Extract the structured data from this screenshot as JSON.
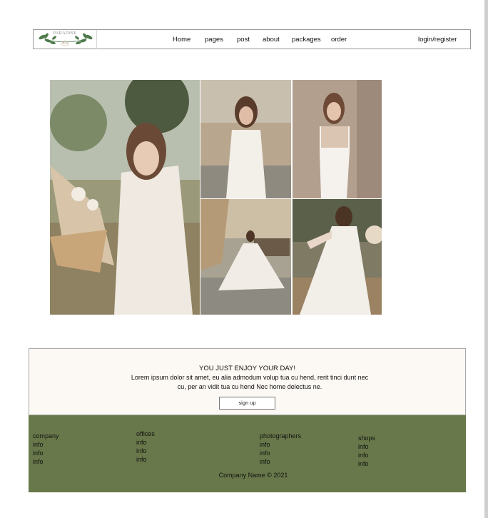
{
  "nav": {
    "logo_text": "PARADISE",
    "links": [
      "Home",
      "pages",
      "post",
      "about",
      "packages",
      "order"
    ],
    "login": "login/register"
  },
  "gallery": {
    "photos": [
      "bride-with-bouquet",
      "bride-in-garden",
      "bride-by-stone-wall",
      "bride-twirling-at-table",
      "bride-in-meadow"
    ]
  },
  "cta": {
    "heading": "YOU JUST ENJOY YOUR DAY!",
    "body": "Lorem ipsum dolor sit amet, eu alia admodum volup tua cu hend, rerit tinci dunt nec cu, per an vidit tua cu hend Nec home delectus ne.",
    "button": "sign up"
  },
  "footer": {
    "columns": [
      {
        "title": "company",
        "items": [
          "info",
          "info",
          "info"
        ]
      },
      {
        "title": "offices",
        "items": [
          "info",
          "info",
          "info"
        ]
      },
      {
        "title": "photographers",
        "items": [
          "info",
          "info",
          "info"
        ]
      },
      {
        "title": "shops",
        "items": [
          "info",
          "info",
          "info"
        ]
      }
    ],
    "copyright": "Company Name © 2021"
  },
  "colors": {
    "footer_bg": "#68784a",
    "cta_bg": "#fcf8f3",
    "leaf": "#4e7a4b"
  }
}
